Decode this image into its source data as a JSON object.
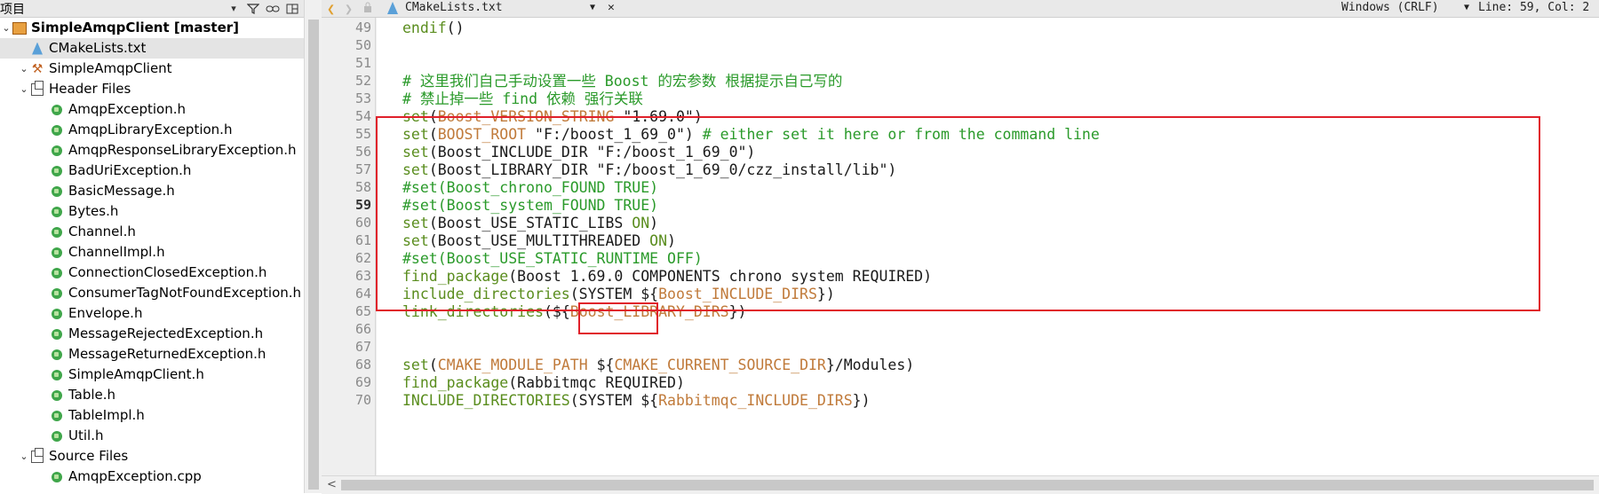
{
  "project_panel": {
    "title": "项目",
    "filter_icon": "filter-icon",
    "link_icon": "link-icon",
    "split_icon": "split-icon",
    "close_icon": "close-panel-icon",
    "tree": [
      {
        "label": "SimpleAmqpClient [master]",
        "level": 0,
        "icon": "project-icon",
        "expanded": true,
        "bold": true
      },
      {
        "label": "CMakeLists.txt",
        "level": 1,
        "icon": "cmake-file-icon",
        "selected": true
      },
      {
        "label": "SimpleAmqpClient",
        "level": 1,
        "icon": "build-target-icon",
        "expanded": true
      },
      {
        "label": "Header Files",
        "level": 2,
        "icon": "folder-icon",
        "expanded": true
      },
      {
        "label": "AmqpException.h",
        "level": 3,
        "icon": "header-file-icon"
      },
      {
        "label": "AmqpLibraryException.h",
        "level": 3,
        "icon": "header-file-icon"
      },
      {
        "label": "AmqpResponseLibraryException.h",
        "level": 3,
        "icon": "header-file-icon"
      },
      {
        "label": "BadUriException.h",
        "level": 3,
        "icon": "header-file-icon"
      },
      {
        "label": "BasicMessage.h",
        "level": 3,
        "icon": "header-file-icon"
      },
      {
        "label": "Bytes.h",
        "level": 3,
        "icon": "header-file-icon"
      },
      {
        "label": "Channel.h",
        "level": 3,
        "icon": "header-file-icon"
      },
      {
        "label": "ChannelImpl.h",
        "level": 3,
        "icon": "header-file-icon"
      },
      {
        "label": "ConnectionClosedException.h",
        "level": 3,
        "icon": "header-file-icon"
      },
      {
        "label": "ConsumerTagNotFoundException.h",
        "level": 3,
        "icon": "header-file-icon"
      },
      {
        "label": "Envelope.h",
        "level": 3,
        "icon": "header-file-icon"
      },
      {
        "label": "MessageRejectedException.h",
        "level": 3,
        "icon": "header-file-icon"
      },
      {
        "label": "MessageReturnedException.h",
        "level": 3,
        "icon": "header-file-icon"
      },
      {
        "label": "SimpleAmqpClient.h",
        "level": 3,
        "icon": "header-file-icon"
      },
      {
        "label": "Table.h",
        "level": 3,
        "icon": "header-file-icon"
      },
      {
        "label": "TableImpl.h",
        "level": 3,
        "icon": "header-file-icon"
      },
      {
        "label": "Util.h",
        "level": 3,
        "icon": "header-file-icon"
      },
      {
        "label": "Source Files",
        "level": 2,
        "icon": "folder-icon",
        "expanded": true
      },
      {
        "label": "AmqpException.cpp",
        "level": 3,
        "icon": "source-file-icon"
      }
    ]
  },
  "editor_toolbar": {
    "back_icon": "back-arrow-icon",
    "forward_icon": "forward-arrow-icon",
    "lock_icon": "lock-icon",
    "file_icon": "cmake-file-icon",
    "file_name": "CMakeLists.txt",
    "dropdown_icon": "dropdown-icon",
    "close_icon": "close-doc-icon",
    "line_ending": "Windows (CRLF)",
    "cursor_position": "Line: 59, Col: 2"
  },
  "editor": {
    "current_line": "59",
    "lines": [
      {
        "num": "49",
        "tokens": [
          [
            "kw",
            "endif"
          ],
          [
            "op",
            "()"
          ]
        ]
      },
      {
        "num": "50",
        "tokens": []
      },
      {
        "num": "51",
        "tokens": []
      },
      {
        "num": "52",
        "tokens": [
          [
            "cm",
            "# 这里我们自己手动设置一些 Boost 的宏参数 根据提示自己写的"
          ]
        ]
      },
      {
        "num": "53",
        "tokens": [
          [
            "cm",
            "# 禁止掉一些 find 依赖 强行关联"
          ]
        ]
      },
      {
        "num": "54",
        "tokens": [
          [
            "kw",
            "set"
          ],
          [
            "op",
            "("
          ],
          [
            "ph",
            "Boost_VERSION_STRING"
          ],
          [
            "op",
            " \""
          ],
          [
            "st",
            "1.69.0"
          ],
          [
            "op",
            "\")"
          ]
        ]
      },
      {
        "num": "55",
        "tokens": [
          [
            "kw",
            "set"
          ],
          [
            "op",
            "("
          ],
          [
            "ph",
            "BOOST_ROOT"
          ],
          [
            "op",
            " \"F:/boost_1_69_0\") "
          ],
          [
            "cm",
            "# either set it here or from the command line"
          ]
        ]
      },
      {
        "num": "56",
        "tokens": [
          [
            "kw",
            "set"
          ],
          [
            "op",
            "(Boost_INCLUDE_DIR \"F:/boost_1_69_0\")"
          ]
        ]
      },
      {
        "num": "57",
        "tokens": [
          [
            "kw",
            "set"
          ],
          [
            "op",
            "(Boost_LIBRARY_DIR \"F:/boost_1_69_0/czz_install/lib\")"
          ]
        ]
      },
      {
        "num": "58",
        "tokens": [
          [
            "cm",
            "#set(Boost_chrono_FOUND TRUE)"
          ]
        ]
      },
      {
        "num": "59",
        "tokens": [
          [
            "cm",
            "#set(Boost_system_FOUND TRUE)"
          ]
        ]
      },
      {
        "num": "60",
        "tokens": [
          [
            "kw",
            "set"
          ],
          [
            "op",
            "(Boost_USE_STATIC_LIBS "
          ],
          [
            "kw",
            "ON"
          ],
          [
            "op",
            ")"
          ]
        ]
      },
      {
        "num": "61",
        "tokens": [
          [
            "kw",
            "set"
          ],
          [
            "op",
            "(Boost_USE_MULTITHREADED "
          ],
          [
            "kw",
            "ON"
          ],
          [
            "op",
            ")"
          ]
        ]
      },
      {
        "num": "62",
        "tokens": [
          [
            "cm",
            "#set(Boost_USE_STATIC_RUNTIME OFF)"
          ]
        ]
      },
      {
        "num": "63",
        "tokens": [
          [
            "kw",
            "find_package"
          ],
          [
            "op",
            "(Boost 1.69.0 COMPONENTS chrono system REQUIRED)"
          ]
        ]
      },
      {
        "num": "64",
        "tokens": [
          [
            "kw",
            "include_directories"
          ],
          [
            "op",
            "(SYSTEM ${"
          ],
          [
            "ph",
            "Boost_INCLUDE_DIRS"
          ],
          [
            "op",
            "})"
          ]
        ]
      },
      {
        "num": "65",
        "tokens": [
          [
            "kw",
            "link_directories"
          ],
          [
            "op",
            "(${"
          ],
          [
            "ph",
            "Boost_LIBRARY_DIRS"
          ],
          [
            "op",
            "})"
          ]
        ]
      },
      {
        "num": "66",
        "tokens": []
      },
      {
        "num": "67",
        "tokens": []
      },
      {
        "num": "68",
        "tokens": [
          [
            "kw",
            "set"
          ],
          [
            "op",
            "("
          ],
          [
            "ph",
            "CMAKE_MODULE_PATH"
          ],
          [
            "op",
            " ${"
          ],
          [
            "ph",
            "CMAKE_CURRENT_SOURCE_DIR"
          ],
          [
            "op",
            "}/Modules)"
          ]
        ]
      },
      {
        "num": "69",
        "tokens": [
          [
            "kw",
            "find_package"
          ],
          [
            "op",
            "(Rabbitmqc REQUIRED)"
          ]
        ]
      },
      {
        "num": "70",
        "tokens": [
          [
            "kw",
            "INCLUDE_DIRECTORIES"
          ],
          [
            "op",
            "(SYSTEM ${"
          ],
          [
            "ph",
            "Rabbitmqc_INCLUDE_DIRS"
          ],
          [
            "op",
            "})"
          ]
        ]
      }
    ]
  },
  "colors": {
    "highlight_box": "#e0202a",
    "keyword": "#5a8d1e",
    "comment": "#2a9a2a",
    "variable": "#c07a3a"
  }
}
